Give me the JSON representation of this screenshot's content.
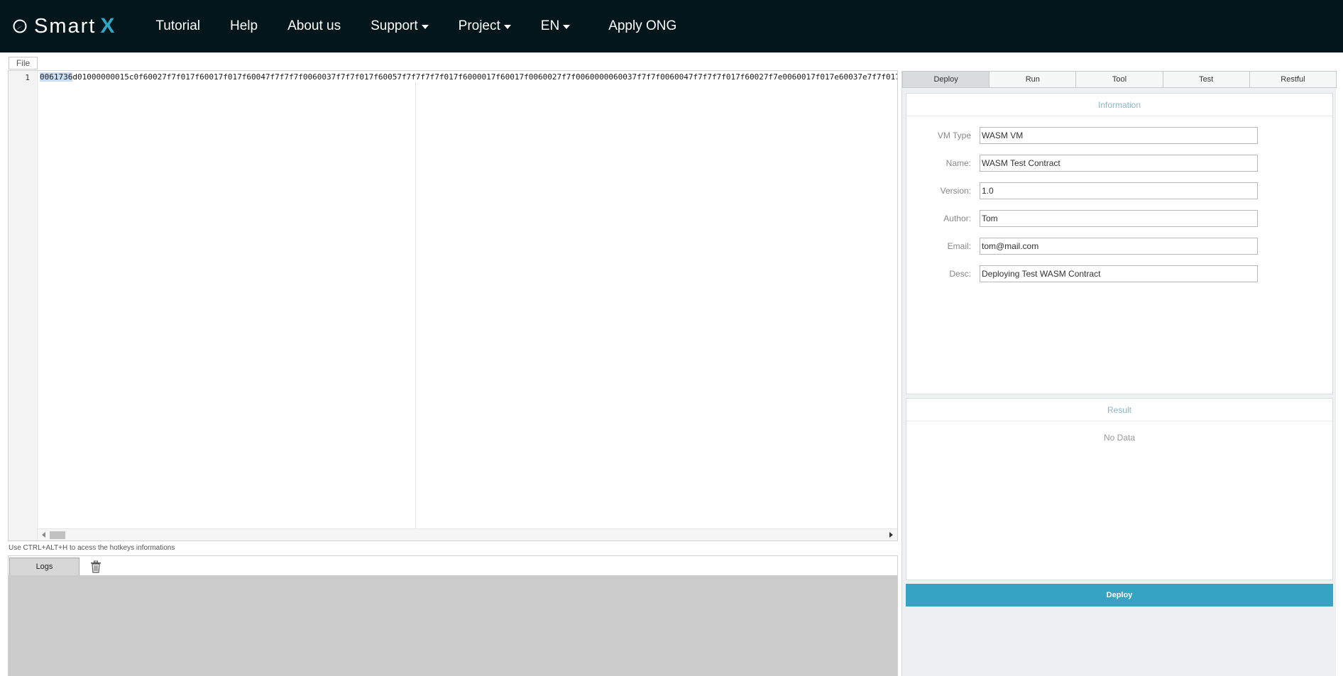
{
  "brand": {
    "name": "Smart",
    "suffix": "X"
  },
  "nav": {
    "items": [
      {
        "label": "Tutorial"
      },
      {
        "label": "Help"
      },
      {
        "label": "About us"
      },
      {
        "label": "Support"
      },
      {
        "label": "Project"
      },
      {
        "label": "EN"
      },
      {
        "label": "Apply ONG"
      }
    ]
  },
  "editor": {
    "file_menu": "File",
    "line_number": "1",
    "code_selected": "0061736",
    "code_rest": "d01000000015c0f60027f7f017f60017f017f60047f7f7f7f0060037f7f7f017f60057f7f7f7f7f017f6000017f60017f0060027f7f0060000060037f7f7f0060047f7f7f7f017f60027f7e0060017f017e60037e7f7f017",
    "hint": "Use CTRL+ALT+H to acess the hotkeys informations"
  },
  "logs": {
    "button": "Logs"
  },
  "panel": {
    "tabs": [
      "Deploy",
      "Run",
      "Tool",
      "Test",
      "Restful"
    ],
    "info_title": "Information",
    "fields": {
      "vm_type": {
        "label": "VM Type",
        "value": "WASM VM"
      },
      "name": {
        "label": "Name:",
        "value": "WASM Test Contract"
      },
      "version": {
        "label": "Version:",
        "value": "1.0"
      },
      "author": {
        "label": "Author:",
        "value": "Tom"
      },
      "email": {
        "label": "Email:",
        "value": "tom@mail.com"
      },
      "desc": {
        "label": "Desc:",
        "value": "Deploying Test WASM Contract"
      }
    },
    "result_title": "Result",
    "result_empty": "No Data",
    "deploy_button": "Deploy"
  },
  "colors": {
    "navbar_bg": "#03161b",
    "accent": "#35a3c1",
    "panel_bg": "#edf1f2",
    "logs_bg": "#cbcbcb"
  }
}
